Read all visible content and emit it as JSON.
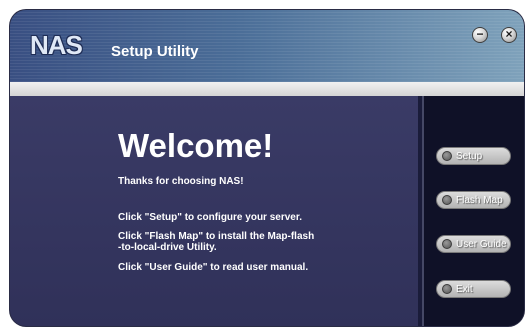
{
  "title_bar": {
    "logo": "NAS",
    "title": "Setup Utility",
    "minimize_glyph": "−",
    "close_glyph": "×"
  },
  "main": {
    "heading": "Welcome!",
    "thanks": "Thanks for choosing NAS!",
    "line_setup": "Click \"Setup\" to configure your server.",
    "line_flash_1": "Click \"Flash Map\" to install the Map-flash",
    "line_flash_2": "-to-local-drive Utility.",
    "line_guide": "Click \"User Guide\" to read user manual."
  },
  "sidebar": {
    "buttons": [
      {
        "label": "Setup"
      },
      {
        "label": "Flash Map"
      },
      {
        "label": "User Guide"
      },
      {
        "label": "Exit"
      }
    ]
  },
  "colors": {
    "main_panel": "#35365f",
    "sidebar": "#0f1127",
    "title_gradient_start": "#394f82",
    "title_gradient_end": "#7fa2bb"
  }
}
